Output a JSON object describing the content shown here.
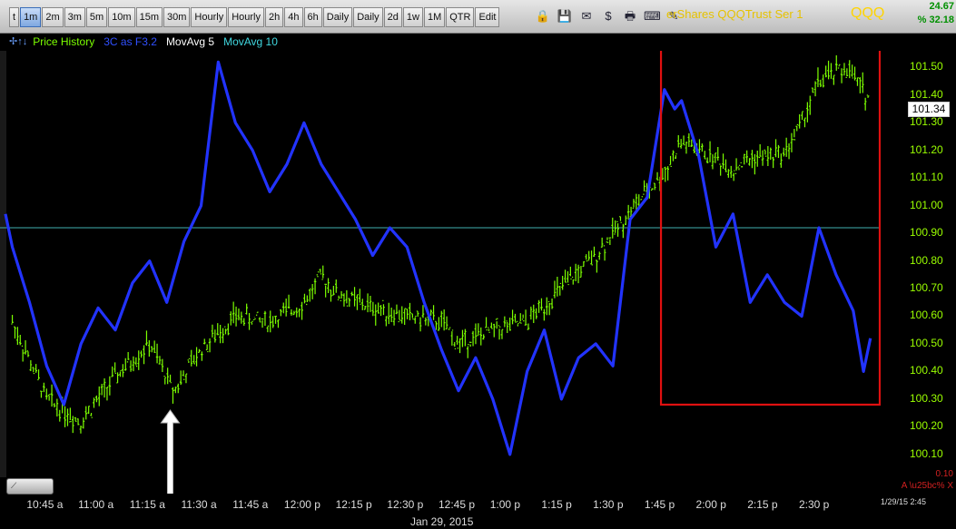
{
  "toolbar": {
    "timeframes": [
      {
        "label": "t",
        "active": false
      },
      {
        "label": "1m",
        "active": true
      },
      {
        "label": "2m",
        "active": false
      },
      {
        "label": "3m",
        "active": false
      },
      {
        "label": "5m",
        "active": false
      },
      {
        "label": "10m",
        "active": false
      },
      {
        "label": "15m",
        "active": false
      },
      {
        "label": "30m",
        "active": false
      },
      {
        "label": "Hourly",
        "active": false
      },
      {
        "label": "Hourly",
        "active": false
      },
      {
        "label": "2h",
        "active": false
      },
      {
        "label": "4h",
        "active": false
      },
      {
        "label": "6h",
        "active": false
      },
      {
        "label": "Daily",
        "active": false
      },
      {
        "label": "Daily",
        "active": false
      },
      {
        "label": "2d",
        "active": false
      },
      {
        "label": "1w",
        "active": false
      },
      {
        "label": "1M",
        "active": false
      },
      {
        "label": "QTR",
        "active": false
      },
      {
        "label": "Edit",
        "active": false
      }
    ],
    "tool_icons": [
      {
        "name": "lock-icon",
        "glyph": "🔒"
      },
      {
        "name": "save-icon",
        "glyph": "💾"
      },
      {
        "name": "email-icon",
        "glyph": "✉"
      },
      {
        "name": "dollar-icon",
        "glyph": "$"
      },
      {
        "name": "print-icon",
        "glyph": "🖶"
      },
      {
        "name": "keyboard-icon",
        "glyph": "⌨"
      },
      {
        "name": "pin-icon",
        "glyph": "✎"
      }
    ],
    "security_name": "erShares QQQTrust Ser 1",
    "symbol": "QQQ",
    "stat_value": "24.67",
    "stat_pct": "% 32.18"
  },
  "legend": {
    "arrows": "✢↑↓",
    "items": [
      {
        "text": "Price History",
        "color": "#7cff00"
      },
      {
        "text": "3C as F3.2",
        "color": "#3050ff"
      },
      {
        "text": "MovAvg 5",
        "color": "#ffffff"
      },
      {
        "text": "MovAvg 10",
        "color": "#40d8e0"
      }
    ]
  },
  "right_axis": {
    "ticks": [
      "101.50",
      "101.40",
      "101.30",
      "101.20",
      "101.10",
      "101.00",
      "100.90",
      "100.80",
      "100.70",
      "100.60",
      "100.50",
      "100.40",
      "100.30",
      "100.20",
      "100.10"
    ],
    "last_price": "101.34",
    "vol_value": "0.10",
    "vol_indicator": "A \\u25bc% X",
    "date": "1/29/15 2:45"
  },
  "x_axis": {
    "ticks": [
      "10:45 a",
      "11:00 a",
      "11:15 a",
      "11:30 a",
      "11:45 a",
      "12:00 p",
      "12:15 p",
      "12:30 p",
      "12:45 p",
      "1:00 p",
      "1:15 p",
      "1:30 p",
      "1:45 p",
      "2:00 p",
      "2:15 p",
      "2:30 p"
    ],
    "date_label": "Jan 29, 2015"
  },
  "colors": {
    "price": "#7cff00",
    "indicator": "#2233ff",
    "reference_line": "#40b0b0",
    "highlight_box": "#e01010",
    "arrow": "#ffffff"
  },
  "chart_data": {
    "type": "line",
    "series": [
      {
        "name": "Price History",
        "x": [
          "10:35",
          "10:45",
          "10:55",
          "11:05",
          "11:15",
          "11:22",
          "11:30",
          "11:40",
          "11:50",
          "12:00",
          "12:05",
          "12:10",
          "12:20",
          "12:30",
          "12:40",
          "12:45",
          "12:55",
          "1:05",
          "1:15",
          "1:25",
          "1:35",
          "1:45",
          "1:50",
          "2:00",
          "2:05",
          "2:10",
          "2:20",
          "2:25",
          "2:30",
          "2:38",
          "2:45"
        ],
        "y": [
          100.58,
          100.3,
          100.22,
          100.38,
          100.5,
          100.33,
          100.48,
          100.6,
          100.58,
          100.65,
          100.74,
          100.68,
          100.63,
          100.6,
          100.58,
          100.5,
          100.55,
          100.58,
          100.7,
          100.82,
          100.98,
          101.12,
          101.23,
          101.17,
          101.13,
          101.17,
          101.19,
          101.3,
          101.45,
          101.5,
          101.38
        ]
      },
      {
        "name": "3C as F3.2",
        "x": [
          "10:33",
          "10:35",
          "10:40",
          "10:45",
          "10:50",
          "10:55",
          "11:00",
          "11:05",
          "11:10",
          "11:15",
          "11:20",
          "11:25",
          "11:30",
          "11:35",
          "11:40",
          "11:45",
          "11:50",
          "11:55",
          "12:00",
          "12:05",
          "12:10",
          "12:15",
          "12:20",
          "12:25",
          "12:30",
          "12:35",
          "12:40",
          "12:45",
          "12:50",
          "12:55",
          "1:00",
          "1:05",
          "1:10",
          "1:15",
          "1:20",
          "1:25",
          "1:30",
          "1:35",
          "1:40",
          "1:45",
          "1:48",
          "1:50",
          "1:55",
          "2:00",
          "2:05",
          "2:10",
          "2:15",
          "2:20",
          "2:25",
          "2:30",
          "2:35",
          "2:40",
          "2:43",
          "2:45"
        ],
        "y": [
          100.97,
          100.85,
          100.65,
          100.42,
          100.28,
          100.5,
          100.63,
          100.55,
          100.72,
          100.8,
          100.65,
          100.87,
          101.0,
          101.52,
          101.3,
          101.2,
          101.05,
          101.15,
          101.3,
          101.15,
          101.05,
          100.95,
          100.82,
          100.92,
          100.85,
          100.65,
          100.48,
          100.33,
          100.45,
          100.3,
          100.1,
          100.4,
          100.55,
          100.3,
          100.45,
          100.5,
          100.42,
          100.95,
          101.03,
          101.42,
          101.35,
          101.38,
          101.18,
          100.85,
          100.97,
          100.65,
          100.75,
          100.65,
          100.6,
          100.92,
          100.75,
          100.62,
          100.4,
          100.52
        ]
      }
    ],
    "reference_line_y": 100.92,
    "ylim": [
      100.05,
      101.58
    ],
    "y_ticks": [
      101.5,
      101.4,
      101.3,
      101.2,
      101.1,
      101.0,
      100.9,
      100.8,
      100.7,
      100.6,
      100.5,
      100.4,
      100.3,
      100.2,
      100.1
    ],
    "x_range": [
      "10:33",
      "2:48"
    ],
    "grid": false,
    "highlight_box": {
      "x_start": "1:44",
      "x_end": "2:48",
      "y_min": 100.28,
      "y_max": 101.69
    },
    "arrow_annotation": {
      "x": "11:21",
      "y_tip": 100.26
    }
  }
}
